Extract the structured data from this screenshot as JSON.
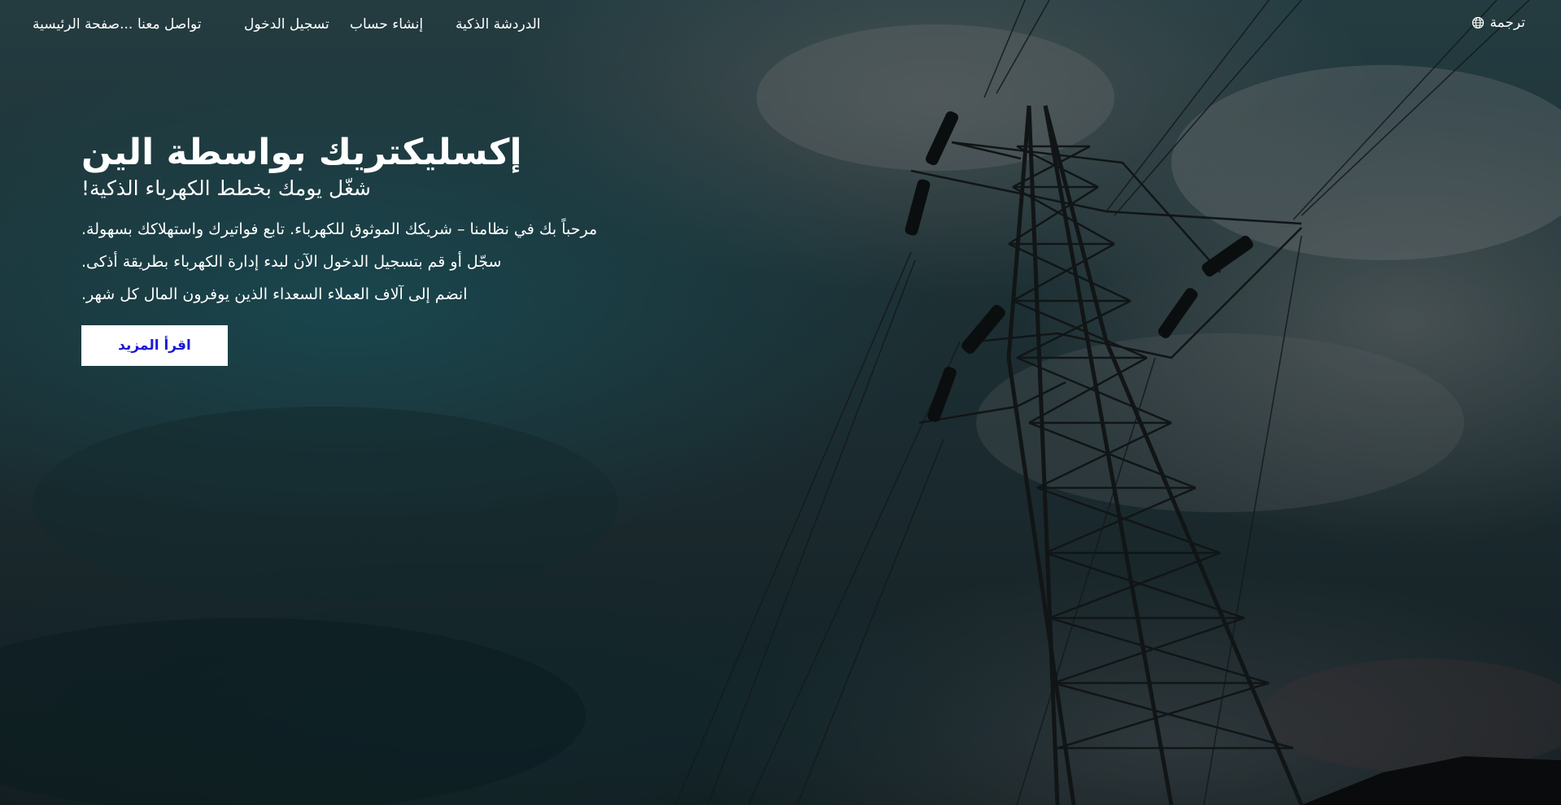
{
  "nav": {
    "home": "صفحة الرئيسية...",
    "contact": "تواصل معنا",
    "login": "تسجيل الدخول",
    "register": "إنشاء حساب",
    "chat": "الدردشة الذكية",
    "translate": "ترجمة",
    "translate_icon": "globe-icon"
  },
  "hero": {
    "title": "إكسليكتريك بواسطة الين",
    "subtitle": "شغّل يومك بخطط الكهرباء الذكية!",
    "paragraphs": [
      "مرحباً بك في نظامنا – شريكك الموثوق للكهرباء. تابع فواتيرك واستهلاكك بسهولة.",
      "سجّل أو قم بتسجيل الدخول الآن لبدء إدارة الكهرباء بطريقة أذكى.",
      "انضم إلى آلاف العملاء السعداء الذين يوفرون المال كل شهر."
    ],
    "cta": "اقرأ المزيد"
  },
  "colors": {
    "cta_text": "#1a1ad6",
    "text": "#ffffff"
  }
}
